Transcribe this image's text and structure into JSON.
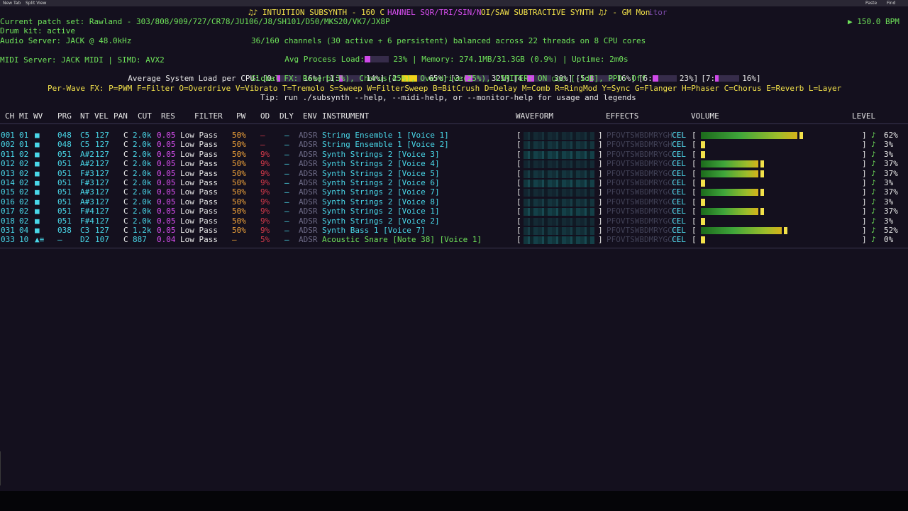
{
  "browser": {
    "tabs": [
      "New Tab",
      "Split View"
    ],
    "controls": [
      "Paste",
      "Find"
    ]
  },
  "title": {
    "prefix": "♫♪ INTUITION SUBSYNTH - 160 C",
    "mid": "HANNEL SQR/TRI/SIN/N",
    "suffix": "OI/SAW SUBTRACTIVE SYNTH ♫♪ - GM Mon",
    "tail": "itor"
  },
  "status": {
    "patch": "Current patch set: Rawland - 303/808/909/727/CR78/JU106/J8/SH101/D50/MKS20/VK7/JX8P",
    "drum": "Drum kit: active",
    "audio": "Audio Server: JACK @ 48.0kHz",
    "midi": "MIDI Server: JACK MIDI | SIMD: AVX2",
    "bpm": "▶ 150.0 BPM",
    "channels": "36/160 channels (30 active + 6 persistent) balanced across 22 threads on 8 CPU cores",
    "avg_load_label": "Avg Process Load:",
    "avg_load_value": "23%",
    "avg_load_fraction": 0.23,
    "memory": "| Memory: 274.1MB/31.3GB (0.9%) | Uptime: 2m0s",
    "cpu_label": "Average System Load per CPU:",
    "cpus": [
      {
        "label": "[0:",
        "value": "16%]",
        "fraction": 0.16
      },
      {
        "label": "[1:",
        "value": "14%]",
        "fraction": 0.14
      },
      {
        "label": "[2:",
        "value": "65%]",
        "fraction": 0.65
      },
      {
        "label": "[3:",
        "value": "32%]",
        "fraction": 0.32
      },
      {
        "label": "[4:",
        "value": "30%]",
        "fraction": 0.3
      },
      {
        "label": "[5:",
        "value": "16%]",
        "fraction": 0.16
      },
      {
        "label": "[6:",
        "value": "23%]",
        "fraction": 0.23
      },
      {
        "label": "[7:",
        "value": "16%]",
        "fraction": 0.16
      }
    ],
    "global_fx": "Global FX: Reverb(3%), Chorus(45%), Overdrive(25%), LIMITER: ON ○○○ [-1dB], PPD: Off",
    "perwave": "Per-Wave FX: P=PWM F=Filter O=Overdrive V=Vibrato T=Tremolo S=Sweep W=FilterSweep B=BitCrush D=Delay M=Comb R=RingMod Y=Sync G=Flanger H=Phaser C=Chorus E=Reverb L=Layer",
    "tip": "Tip: run ./subsynth --help, --midi-help, or --monitor-help for usage and legends"
  },
  "table": {
    "headers": [
      "CH",
      "MI",
      "WV",
      "PRG",
      "NT",
      "VEL",
      "PAN",
      "CUT",
      "RES",
      "FILTER",
      "PW",
      "OD",
      "DLY",
      "ENV",
      "INSTRUMENT",
      "WAVEFORM",
      "EFFECTS",
      "VOLUME",
      "LEVEL"
    ],
    "rows": [
      {
        "ch": "001",
        "mi": "01",
        "wv": "■",
        "prg": "048",
        "nt": "C5",
        "vel": "127",
        "pan": "C",
        "cut": "2.0k",
        "res": "0.05",
        "filter": "Low Pass",
        "pw": "50%",
        "od": "—",
        "dly": "—",
        "env": "ADSR",
        "inst": "String Ensemble 1 [Voice 1]",
        "fx": "PFOVTSWBDMRYGHCEL",
        "vol": 0.62,
        "level": "62%",
        "peak": true
      },
      {
        "ch": "002",
        "mi": "01",
        "wv": "■",
        "prg": "048",
        "nt": "C5",
        "vel": "127",
        "pan": "C",
        "cut": "2.0k",
        "res": "0.05",
        "filter": "Low Pass",
        "pw": "50%",
        "od": "—",
        "dly": "—",
        "env": "ADSR",
        "inst": "String Ensemble 1 [Voice 2]",
        "fx": "PFOVTSWBDMRYGHCEL",
        "vol": 0.03,
        "level": "3%"
      },
      {
        "ch": "011",
        "mi": "02",
        "wv": "■",
        "prg": "051",
        "nt": "A#2",
        "vel": "127",
        "pan": "C",
        "cut": "2.0k",
        "res": "0.05",
        "filter": "Low Pass",
        "pw": "50%",
        "od": "9%",
        "dly": "—",
        "env": "ADSR",
        "inst": "Synth Strings 2 [Voice 3]",
        "fx": "PFOVTSWBDMRYGCEL",
        "vol": 0.03,
        "level": "3%"
      },
      {
        "ch": "012",
        "mi": "02",
        "wv": "■",
        "prg": "051",
        "nt": "A#2",
        "vel": "127",
        "pan": "C",
        "cut": "2.0k",
        "res": "0.05",
        "filter": "Low Pass",
        "pw": "50%",
        "od": "9%",
        "dly": "—",
        "env": "ADSR",
        "inst": "Synth Strings 2 [Voice 4]",
        "fx": "PFOVTSWBDMRYGCEL",
        "vol": 0.37,
        "level": "37%"
      },
      {
        "ch": "013",
        "mi": "02",
        "wv": "■",
        "prg": "051",
        "nt": "F#3",
        "vel": "127",
        "pan": "C",
        "cut": "2.0k",
        "res": "0.05",
        "filter": "Low Pass",
        "pw": "50%",
        "od": "9%",
        "dly": "—",
        "env": "ADSR",
        "inst": "Synth Strings 2 [Voice 5]",
        "fx": "PFOVTSWBDMRYGCEL",
        "vol": 0.37,
        "level": "37%"
      },
      {
        "ch": "014",
        "mi": "02",
        "wv": "■",
        "prg": "051",
        "nt": "F#3",
        "vel": "127",
        "pan": "C",
        "cut": "2.0k",
        "res": "0.05",
        "filter": "Low Pass",
        "pw": "50%",
        "od": "9%",
        "dly": "—",
        "env": "ADSR",
        "inst": "Synth Strings 2 [Voice 6]",
        "fx": "PFOVTSWBDMRYGCEL",
        "vol": 0.03,
        "level": "3%"
      },
      {
        "ch": "015",
        "mi": "02",
        "wv": "■",
        "prg": "051",
        "nt": "A#3",
        "vel": "127",
        "pan": "C",
        "cut": "2.0k",
        "res": "0.05",
        "filter": "Low Pass",
        "pw": "50%",
        "od": "9%",
        "dly": "—",
        "env": "ADSR",
        "inst": "Synth Strings 2 [Voice 7]",
        "fx": "PFOVTSWBDMRYGCEL",
        "vol": 0.37,
        "level": "37%"
      },
      {
        "ch": "016",
        "mi": "02",
        "wv": "■",
        "prg": "051",
        "nt": "A#3",
        "vel": "127",
        "pan": "C",
        "cut": "2.0k",
        "res": "0.05",
        "filter": "Low Pass",
        "pw": "50%",
        "od": "9%",
        "dly": "—",
        "env": "ADSR",
        "inst": "Synth Strings 2 [Voice 8]",
        "fx": "PFOVTSWBDMRYGCEL",
        "vol": 0.03,
        "level": "3%"
      },
      {
        "ch": "017",
        "mi": "02",
        "wv": "■",
        "prg": "051",
        "nt": "F#4",
        "vel": "127",
        "pan": "C",
        "cut": "2.0k",
        "res": "0.05",
        "filter": "Low Pass",
        "pw": "50%",
        "od": "9%",
        "dly": "—",
        "env": "ADSR",
        "inst": "Synth Strings 2 [Voice 1]",
        "fx": "PFOVTSWBDMRYGCEL",
        "vol": 0.37,
        "level": "37%"
      },
      {
        "ch": "018",
        "mi": "02",
        "wv": "■",
        "prg": "051",
        "nt": "F#4",
        "vel": "127",
        "pan": "C",
        "cut": "2.0k",
        "res": "0.05",
        "filter": "Low Pass",
        "pw": "50%",
        "od": "9%",
        "dly": "—",
        "env": "ADSR",
        "inst": "Synth Strings 2 [Voice 2]",
        "fx": "PFOVTSWBDMRYGCEL",
        "vol": 0.03,
        "level": "3%"
      },
      {
        "ch": "031",
        "mi": "04",
        "wv": "■",
        "prg": "038",
        "nt": "C3",
        "vel": "127",
        "pan": "C",
        "cut": "1.2k",
        "res": "0.05",
        "filter": "Low Pass",
        "pw": "50%",
        "od": "9%",
        "dly": "—",
        "env": "ADSR",
        "inst": "Synth Bass 1 [Voice 7]",
        "fx": "PFOVTSWBDMRYGCEL",
        "vol": 0.52,
        "level": "52%"
      },
      {
        "ch": "033",
        "mi": "10",
        "wv": "▲≡",
        "prg": "—",
        "nt": "D2",
        "vel": "107",
        "pan": "C",
        "cut": "887",
        "res": "0.04",
        "filter": "Low Pass",
        "pw": "—",
        "od": "5%",
        "dly": "—",
        "env": "ADSR",
        "inst": "Acoustic Snare [Note 38] [Voice 1]",
        "fx": "PFOVTSWBDMRYGCEL",
        "vol": 0.03,
        "level": "0%"
      }
    ]
  },
  "colors": {
    "background": "#14101e",
    "green": "#6fe35a",
    "cyan": "#49d7e8",
    "yellow": "#f2e14a",
    "magenta": "#d84ef0",
    "red": "#d63a4a"
  }
}
